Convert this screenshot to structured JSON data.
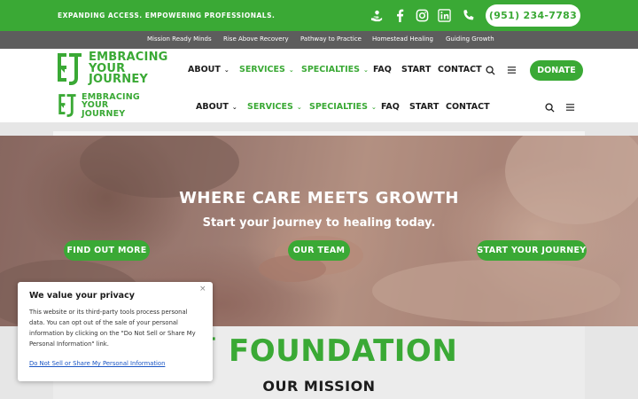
{
  "topbar": {
    "tagline": "EXPANDING ACCESS. EMPOWERING PROFESSIONALS.",
    "phone": "(951) 234-7783",
    "social_icons": [
      "donate-hand-icon",
      "facebook-icon",
      "instagram-icon",
      "linkedin-icon",
      "phone-icon"
    ]
  },
  "subnav": {
    "items": [
      "Mission Ready Minds",
      "Rise Above Recovery",
      "Pathway to Practice",
      "Homestead Healing",
      "Guiding Growth"
    ]
  },
  "logo": {
    "line1": "EMBRACING",
    "line2": "YOUR",
    "line3": "JOURNEY"
  },
  "nav": {
    "about": "ABOUT",
    "services": "SERVICES",
    "specialties": "SPECIALTIES",
    "faq": "FAQ",
    "start": "START",
    "contact": "CONTACT",
    "donate": "DONATE"
  },
  "hero": {
    "title": "WHERE CARE MEETS GROWTH",
    "subtitle": "Start your journey to healing today.",
    "buttons": [
      "FIND OUT MORE",
      "OUR TEAM",
      "START YOUR JOURNEY"
    ]
  },
  "foundation": {
    "title": "FOUNDATION",
    "mission": "OUR MISSION"
  },
  "privacy": {
    "title": "We value your privacy",
    "close": "×",
    "body": "This website or its third-party tools process personal data. You can opt out of the sale of your personal information by clicking on the \"Do Not Sell or Share My Personal Information\" link.",
    "link": "Do Not Sell or Share My Personal Information"
  },
  "colors": {
    "brand_green": "#3aa935",
    "subnav_gray": "#5d5d5d",
    "text_dark": "#1c1c1c"
  }
}
